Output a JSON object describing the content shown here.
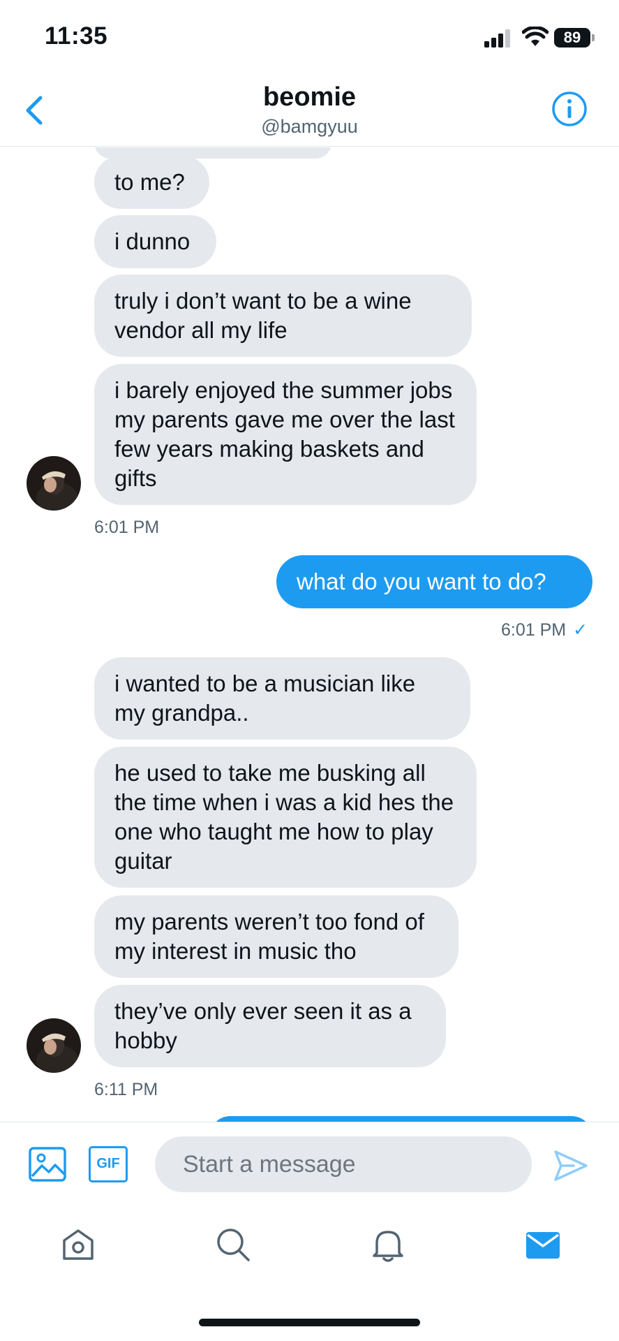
{
  "status_bar": {
    "time": "11:35",
    "battery": "89"
  },
  "header": {
    "name": "beomie",
    "handle": "@bamgyuu"
  },
  "colors": {
    "accent": "#1d9bf0",
    "received_bubble": "#e5e8ed",
    "muted_text": "#536471"
  },
  "icons": [
    "back-chevron-icon",
    "info-icon",
    "image-icon",
    "gif-icon",
    "send-icon",
    "home-icon",
    "search-icon",
    "notifications-bell-icon",
    "messages-envelope-icon",
    "signal-icon",
    "wifi-icon",
    "battery-icon"
  ],
  "messages": {
    "group1": [
      "to me?",
      "i dunno",
      "truly i don’t want to be a wine vendor all my life",
      "i barely enjoyed the summer jobs my parents gave me over the last few years making baskets and gifts"
    ],
    "group1_time": "6:01 PM",
    "sent1": "what do you want to do?",
    "sent1_time": "6:01 PM",
    "sent1_check": "✓",
    "group2": [
      "i wanted to be a musician like my grandpa..",
      "he used to take me busking all the time when i was a kid hes the one who taught me how to play guitar",
      "my parents weren’t too fond of my interest in music tho",
      "they’ve only ever seen it as a hobby"
    ],
    "group2_time": "6:11 PM"
  },
  "composer": {
    "placeholder": "Start a message",
    "gif_label": "GIF"
  }
}
